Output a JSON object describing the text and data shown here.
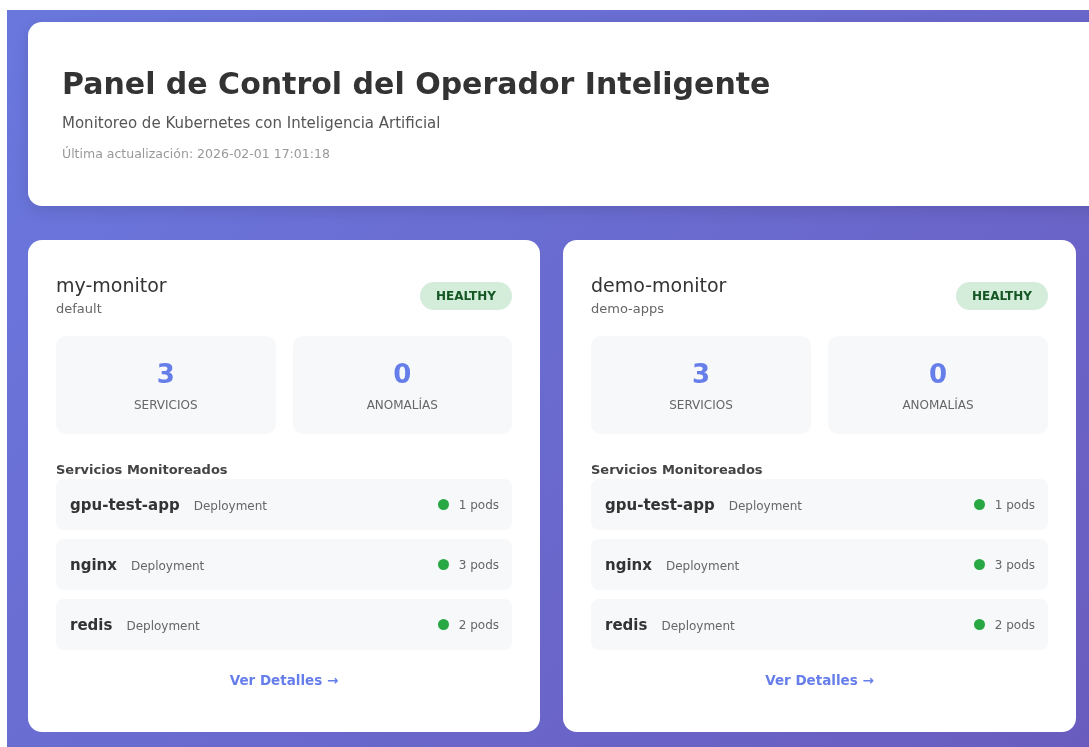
{
  "header": {
    "title": "Panel de Control del Operador Inteligente",
    "subtitle": "Monitoreo de Kubernetes con Inteligencia Artificial",
    "updated": "Última actualización: 2026-02-01 17:01:18"
  },
  "monitors": [
    {
      "name": "my-monitor",
      "namespace": "default",
      "status": {
        "label": "HEALTHY",
        "kind": "healthy"
      },
      "stats": [
        {
          "value": "3",
          "label": "SERVICIOS"
        },
        {
          "value": "0",
          "label": "ANOMALÍAS"
        }
      ],
      "services_title": "Servicios Monitoreados",
      "services": [
        {
          "name": "gpu-test-app",
          "type": "Deployment",
          "pods": "1 pods",
          "color": "#28a745"
        },
        {
          "name": "nginx",
          "type": "Deployment",
          "pods": "3 pods",
          "color": "#28a745"
        },
        {
          "name": "redis",
          "type": "Deployment",
          "pods": "2 pods",
          "color": "#28a745"
        }
      ],
      "link": "Ver Detalles →"
    },
    {
      "name": "demo-monitor",
      "namespace": "demo-apps",
      "status": {
        "label": "HEALTHY",
        "kind": "healthy"
      },
      "stats": [
        {
          "value": "3",
          "label": "SERVICIOS"
        },
        {
          "value": "0",
          "label": "ANOMALÍAS"
        }
      ],
      "services_title": "Servicios Monitoreados",
      "services": [
        {
          "name": "gpu-test-app",
          "type": "Deployment",
          "pods": "1 pods",
          "color": "#28a745"
        },
        {
          "name": "nginx",
          "type": "Deployment",
          "pods": "3 pods",
          "color": "#28a745"
        },
        {
          "name": "redis",
          "type": "Deployment",
          "pods": "2 pods",
          "color": "#28a745"
        }
      ],
      "link": "Ver Detalles →"
    }
  ]
}
